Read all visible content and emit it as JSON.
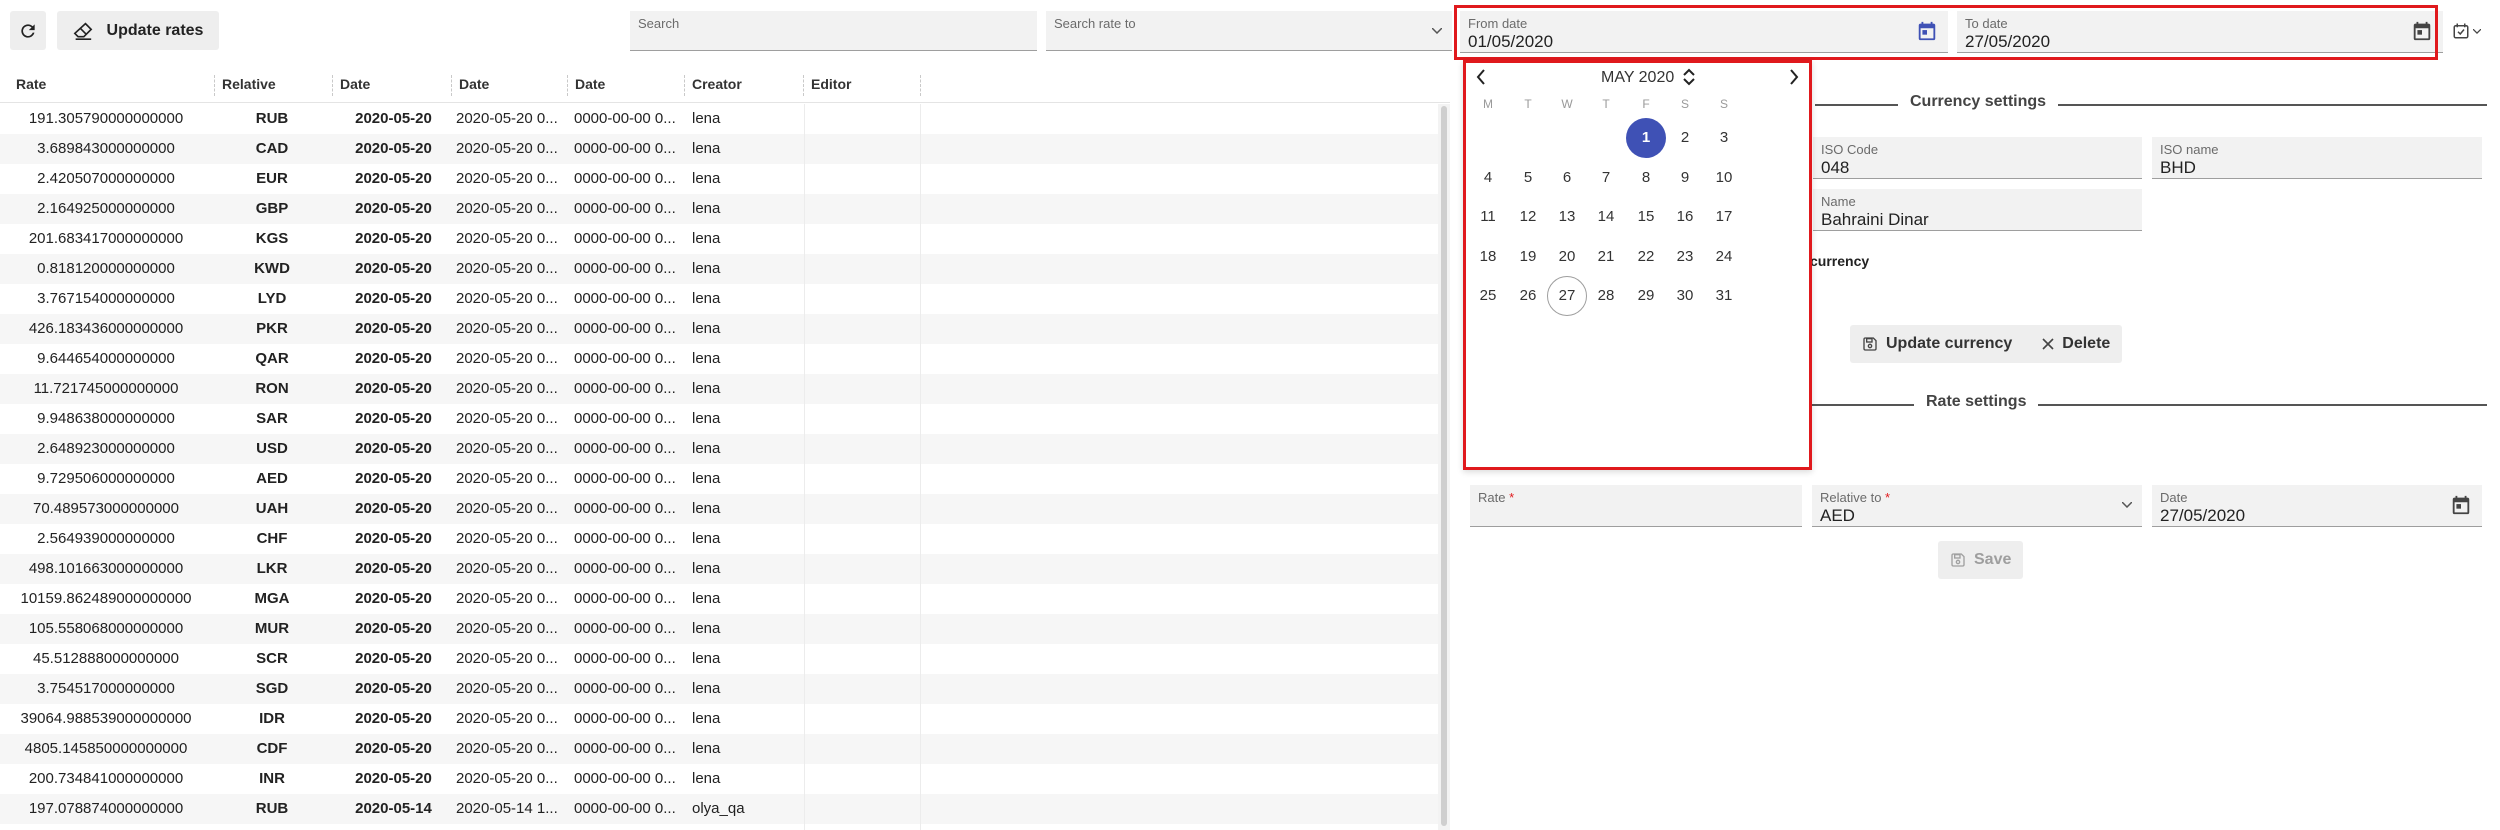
{
  "toolbar": {
    "update_rates_label": "Update rates",
    "search_placeholder": "Search",
    "search_rate_to_placeholder": "Search rate to",
    "from_date_label": "From date",
    "from_date_value": "01/05/2020",
    "to_date_label": "To date",
    "to_date_value": "27/05/2020"
  },
  "table": {
    "headers": [
      "Rate",
      "Relative",
      "Date",
      "Date",
      "Date",
      "Creator",
      "Editor"
    ],
    "rows": [
      {
        "rate": "191.305790000000000",
        "rel": "RUB",
        "d1": "2020-05-20",
        "d2": "2020-05-20 0...",
        "d3": "0000-00-00 0...",
        "cr": "lena",
        "ed": ""
      },
      {
        "rate": "3.689843000000000",
        "rel": "CAD",
        "d1": "2020-05-20",
        "d2": "2020-05-20 0...",
        "d3": "0000-00-00 0...",
        "cr": "lena",
        "ed": ""
      },
      {
        "rate": "2.420507000000000",
        "rel": "EUR",
        "d1": "2020-05-20",
        "d2": "2020-05-20 0...",
        "d3": "0000-00-00 0...",
        "cr": "lena",
        "ed": ""
      },
      {
        "rate": "2.164925000000000",
        "rel": "GBP",
        "d1": "2020-05-20",
        "d2": "2020-05-20 0...",
        "d3": "0000-00-00 0...",
        "cr": "lena",
        "ed": ""
      },
      {
        "rate": "201.683417000000000",
        "rel": "KGS",
        "d1": "2020-05-20",
        "d2": "2020-05-20 0...",
        "d3": "0000-00-00 0...",
        "cr": "lena",
        "ed": ""
      },
      {
        "rate": "0.818120000000000",
        "rel": "KWD",
        "d1": "2020-05-20",
        "d2": "2020-05-20 0...",
        "d3": "0000-00-00 0...",
        "cr": "lena",
        "ed": ""
      },
      {
        "rate": "3.767154000000000",
        "rel": "LYD",
        "d1": "2020-05-20",
        "d2": "2020-05-20 0...",
        "d3": "0000-00-00 0...",
        "cr": "lena",
        "ed": ""
      },
      {
        "rate": "426.183436000000000",
        "rel": "PKR",
        "d1": "2020-05-20",
        "d2": "2020-05-20 0...",
        "d3": "0000-00-00 0...",
        "cr": "lena",
        "ed": ""
      },
      {
        "rate": "9.644654000000000",
        "rel": "QAR",
        "d1": "2020-05-20",
        "d2": "2020-05-20 0...",
        "d3": "0000-00-00 0...",
        "cr": "lena",
        "ed": ""
      },
      {
        "rate": "11.721745000000000",
        "rel": "RON",
        "d1": "2020-05-20",
        "d2": "2020-05-20 0...",
        "d3": "0000-00-00 0...",
        "cr": "lena",
        "ed": ""
      },
      {
        "rate": "9.948638000000000",
        "rel": "SAR",
        "d1": "2020-05-20",
        "d2": "2020-05-20 0...",
        "d3": "0000-00-00 0...",
        "cr": "lena",
        "ed": ""
      },
      {
        "rate": "2.648923000000000",
        "rel": "USD",
        "d1": "2020-05-20",
        "d2": "2020-05-20 0...",
        "d3": "0000-00-00 0...",
        "cr": "lena",
        "ed": ""
      },
      {
        "rate": "9.729506000000000",
        "rel": "AED",
        "d1": "2020-05-20",
        "d2": "2020-05-20 0...",
        "d3": "0000-00-00 0...",
        "cr": "lena",
        "ed": ""
      },
      {
        "rate": "70.489573000000000",
        "rel": "UAH",
        "d1": "2020-05-20",
        "d2": "2020-05-20 0...",
        "d3": "0000-00-00 0...",
        "cr": "lena",
        "ed": ""
      },
      {
        "rate": "2.564939000000000",
        "rel": "CHF",
        "d1": "2020-05-20",
        "d2": "2020-05-20 0...",
        "d3": "0000-00-00 0...",
        "cr": "lena",
        "ed": ""
      },
      {
        "rate": "498.101663000000000",
        "rel": "LKR",
        "d1": "2020-05-20",
        "d2": "2020-05-20 0...",
        "d3": "0000-00-00 0...",
        "cr": "lena",
        "ed": ""
      },
      {
        "rate": "10159.862489000000000",
        "rel": "MGA",
        "d1": "2020-05-20",
        "d2": "2020-05-20 0...",
        "d3": "0000-00-00 0...",
        "cr": "lena",
        "ed": ""
      },
      {
        "rate": "105.558068000000000",
        "rel": "MUR",
        "d1": "2020-05-20",
        "d2": "2020-05-20 0...",
        "d3": "0000-00-00 0...",
        "cr": "lena",
        "ed": ""
      },
      {
        "rate": "45.512888000000000",
        "rel": "SCR",
        "d1": "2020-05-20",
        "d2": "2020-05-20 0...",
        "d3": "0000-00-00 0...",
        "cr": "lena",
        "ed": ""
      },
      {
        "rate": "3.754517000000000",
        "rel": "SGD",
        "d1": "2020-05-20",
        "d2": "2020-05-20 0...",
        "d3": "0000-00-00 0...",
        "cr": "lena",
        "ed": ""
      },
      {
        "rate": "39064.988539000000000",
        "rel": "IDR",
        "d1": "2020-05-20",
        "d2": "2020-05-20 0...",
        "d3": "0000-00-00 0...",
        "cr": "lena",
        "ed": ""
      },
      {
        "rate": "4805.145850000000000",
        "rel": "CDF",
        "d1": "2020-05-20",
        "d2": "2020-05-20 0...",
        "d3": "0000-00-00 0...",
        "cr": "lena",
        "ed": ""
      },
      {
        "rate": "200.734841000000000",
        "rel": "INR",
        "d1": "2020-05-20",
        "d2": "2020-05-20 0...",
        "d3": "0000-00-00 0...",
        "cr": "lena",
        "ed": ""
      },
      {
        "rate": "197.078874000000000",
        "rel": "RUB",
        "d1": "2020-05-14",
        "d2": "2020-05-14 1...",
        "d3": "0000-00-00 0...",
        "cr": "olya_qa",
        "ed": ""
      }
    ]
  },
  "calendar": {
    "month_label": "MAY 2020",
    "weekdays": [
      "M",
      "T",
      "W",
      "T",
      "F",
      "S",
      "S"
    ],
    "first_weekday_index": 4,
    "days_in_month": 31,
    "selected_day": 1,
    "today_day": 27
  },
  "currency_settings": {
    "title": "Currency settings",
    "iso_code_label": "ISO Code",
    "iso_code_value": "048",
    "iso_name_label": "ISO name",
    "iso_name_value": "BHD",
    "name_label": "Name",
    "name_value": "Bahraini Dinar",
    "currency_checkbox_label": "currency",
    "update_button": "Update currency",
    "delete_button": "Delete"
  },
  "rate_settings": {
    "title": "Rate settings",
    "rate_label": "Rate",
    "rate_value": "",
    "relative_label": "Relative to",
    "relative_value": "AED",
    "date_label": "Date",
    "date_value": "27/05/2020",
    "save_button": "Save",
    "required_mark": "*"
  },
  "colors": {
    "accent": "#3f51b5",
    "highlight_red": "#e0191d"
  }
}
